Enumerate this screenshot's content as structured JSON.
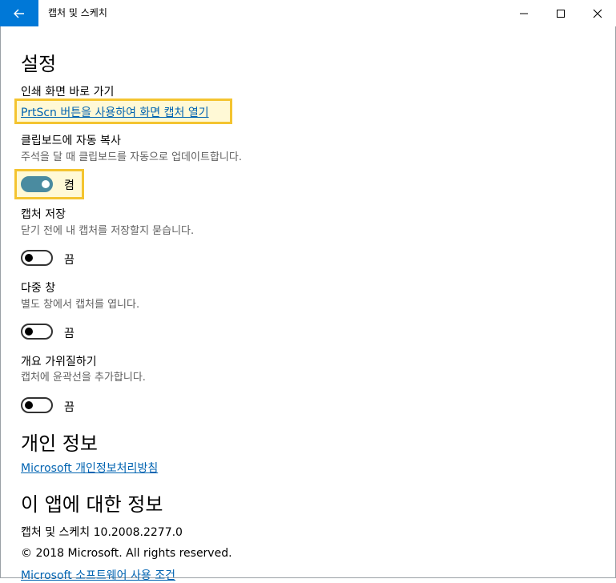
{
  "window": {
    "title": "캡처 및 스케치",
    "back_icon": "back-arrow-icon",
    "accent": "#0078d7"
  },
  "settings": {
    "heading": "설정",
    "print_screen": {
      "label": "인쇄 화면 바로 가기",
      "link": "PrtScn 버튼을 사용하여 화면 캡처 열기"
    },
    "clipboard": {
      "label": "클립보드에 자동 복사",
      "desc": "주석을 달 때 클립보드를 자동으로 업데이트합니다.",
      "state": "켬",
      "on": true
    },
    "save_capture": {
      "label": "캡처 저장",
      "desc": "닫기 전에 내 캡처를 저장할지 묻습니다.",
      "state": "끔",
      "on": false
    },
    "multi_window": {
      "label": "다중 창",
      "desc": "별도 창에서 캡처를 엽니다.",
      "state": "끔",
      "on": false
    },
    "outline": {
      "label": "개요 가위질하기",
      "desc": "캡처에 윤곽선을 추가합니다.",
      "state": "끔",
      "on": false
    }
  },
  "privacy": {
    "heading": "개인 정보",
    "link": "Microsoft 개인정보처리방침"
  },
  "about": {
    "heading": "이 앱에 대한 정보",
    "version": "캡처 및 스케치 10.2008.2277.0",
    "copyright": "© 2018 Microsoft. All rights reserved.",
    "terms_link": "Microsoft 소프트웨어 사용 조건"
  },
  "colors": {
    "highlight_border": "#f4c430",
    "toggle_on": "#4a8ba0",
    "link": "#0063b1"
  }
}
